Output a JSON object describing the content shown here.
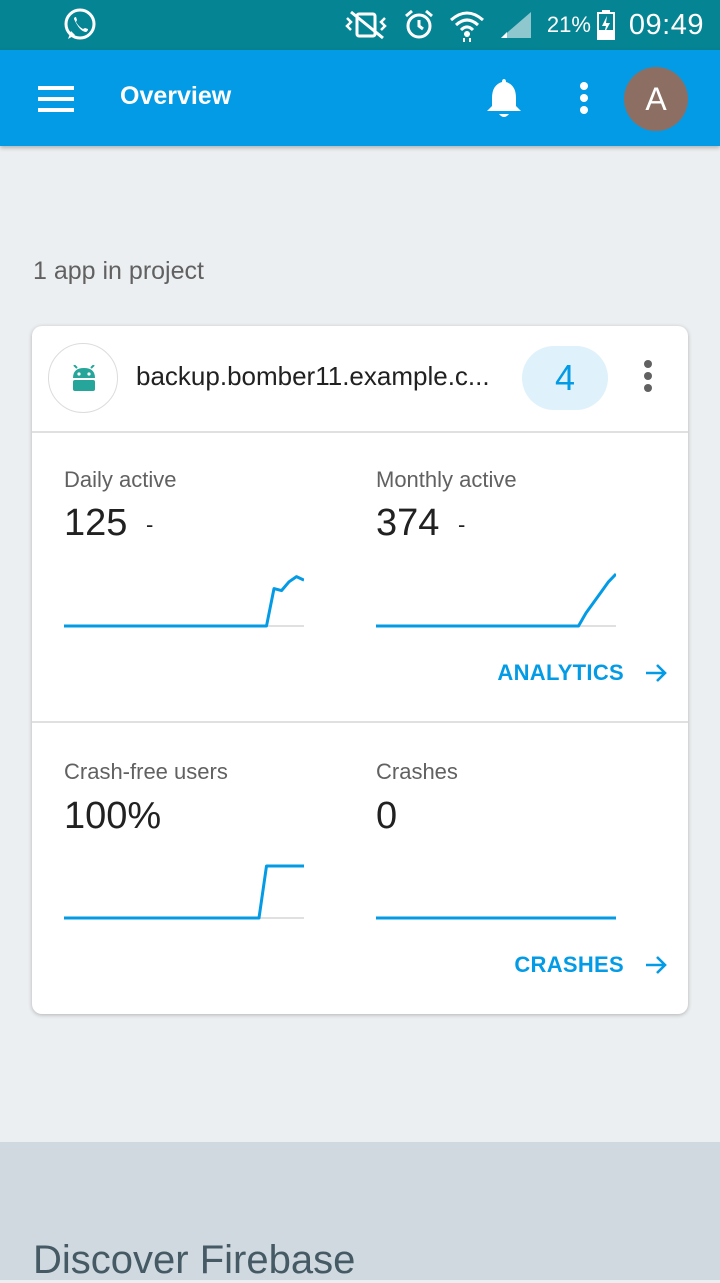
{
  "status_bar": {
    "notification_icon": "whatsapp-icon",
    "icons": [
      "vibrate-off-icon",
      "alarm-icon",
      "wifi-icon",
      "signal-icon"
    ],
    "battery_percent": "21%",
    "time": "09:49",
    "background": "#058493"
  },
  "app_bar": {
    "title": "Overview",
    "avatar_initial": "A",
    "background": "#039be5",
    "avatar_color": "#8d6e63"
  },
  "project": {
    "apps_label": "1 app in project"
  },
  "app_card": {
    "package_name": "backup.bomber11.example.c...",
    "platform_icon": "android-icon",
    "issue_count": "4",
    "analytics": {
      "daily_active": {
        "label": "Daily active",
        "value": "125",
        "delta": "-",
        "sparkline": [
          0,
          0,
          0,
          0,
          0,
          0,
          0,
          0,
          0,
          0,
          0,
          0,
          0,
          0,
          0,
          0,
          0,
          0,
          0,
          0,
          0,
          0,
          0,
          0,
          0,
          0,
          0,
          0,
          0.72,
          0.68,
          0.85,
          0.95,
          0.88
        ]
      },
      "monthly_active": {
        "label": "Monthly active",
        "value": "374",
        "delta": "-",
        "sparkline": [
          0,
          0,
          0,
          0,
          0,
          0,
          0,
          0,
          0,
          0,
          0,
          0,
          0,
          0,
          0,
          0,
          0,
          0,
          0,
          0,
          0,
          0,
          0,
          0,
          0,
          0,
          0,
          0,
          0.25,
          0.45,
          0.65,
          0.85,
          1.0
        ]
      },
      "link_label": "ANALYTICS"
    },
    "crashes": {
      "crash_free_users": {
        "label": "Crash-free users",
        "value": "100%",
        "sparkline": [
          0,
          0,
          0,
          0,
          0,
          0,
          0,
          0,
          0,
          0,
          0,
          0,
          0,
          0,
          0,
          0,
          0,
          0,
          0,
          0,
          0,
          0,
          0,
          0,
          0,
          0,
          0,
          1,
          1,
          1,
          1,
          1,
          1
        ]
      },
      "crashes_count": {
        "label": "Crashes",
        "value": "0",
        "sparkline": [
          0,
          0,
          0,
          0,
          0,
          0,
          0,
          0,
          0,
          0,
          0,
          0,
          0,
          0,
          0,
          0,
          0,
          0,
          0,
          0,
          0,
          0,
          0,
          0,
          0,
          0,
          0,
          0,
          0,
          0,
          0,
          0,
          0
        ]
      },
      "link_label": "CRASHES"
    },
    "accent_color": "#039be5"
  },
  "discover": {
    "title": "Discover Firebase"
  }
}
